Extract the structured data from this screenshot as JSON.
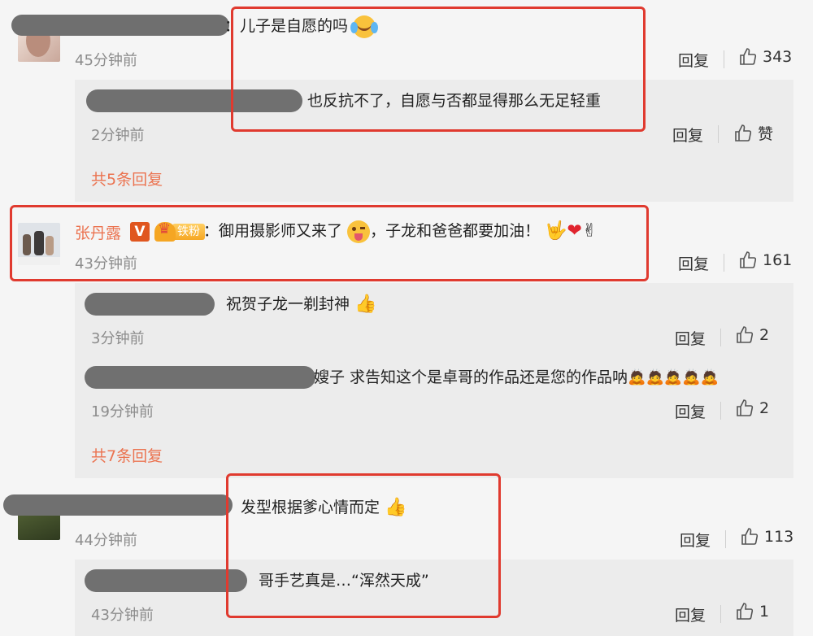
{
  "comments": [
    {
      "text": "：儿子是自愿的吗",
      "time": "45分钟前",
      "reply_label": "回复",
      "likes": "343",
      "replies": [
        {
          "text": "也反抗不了，自愿与否都显得那么无足轻重",
          "time": "2分钟前",
          "reply_label": "回复",
          "likes": "赞"
        }
      ],
      "more": "共5条回复"
    },
    {
      "username": "张丹露",
      "v_badge": "V",
      "fan_label": "铁粉",
      "text_a": "：御用摄影师又来了",
      "text_b": "，子龙和爸爸都要加油！",
      "time": "43分钟前",
      "reply_label": "回复",
      "likes": "161",
      "replies": [
        {
          "text": "祝贺子龙一剃封神",
          "time": "3分钟前",
          "reply_label": "回复",
          "likes": "2"
        },
        {
          "text": "嫂子 求告知这个是卓哥的作品还是您的作品呐",
          "time": "19分钟前",
          "reply_label": "回复",
          "likes": "2"
        }
      ],
      "more": "共7条回复"
    },
    {
      "text": "发型根据爹心情而定",
      "time": "44分钟前",
      "reply_label": "回复",
      "likes": "113",
      "replies": [
        {
          "text": "哥手艺真是…“浑然天成”",
          "time": "43分钟前",
          "reply_label": "回复",
          "likes": "1"
        }
      ]
    }
  ],
  "icons": {
    "like": "thumbs-up-icon",
    "emoji_laugh": "laughing-tears-emoji",
    "emoji_tongue": "tongue-wink-emoji",
    "emoji_thumb": "thumbs-up-emoji",
    "emoji_rock": "rock-hand-emoji",
    "emoji_heart": "red-heart-emoji",
    "emoji_victory": "victory-hand-emoji"
  },
  "colors": {
    "highlight": "#e03a2f",
    "username": "#eb7350",
    "more_link": "#eb7350",
    "background": "#f5f5f5",
    "reply_box": "#ececec"
  }
}
